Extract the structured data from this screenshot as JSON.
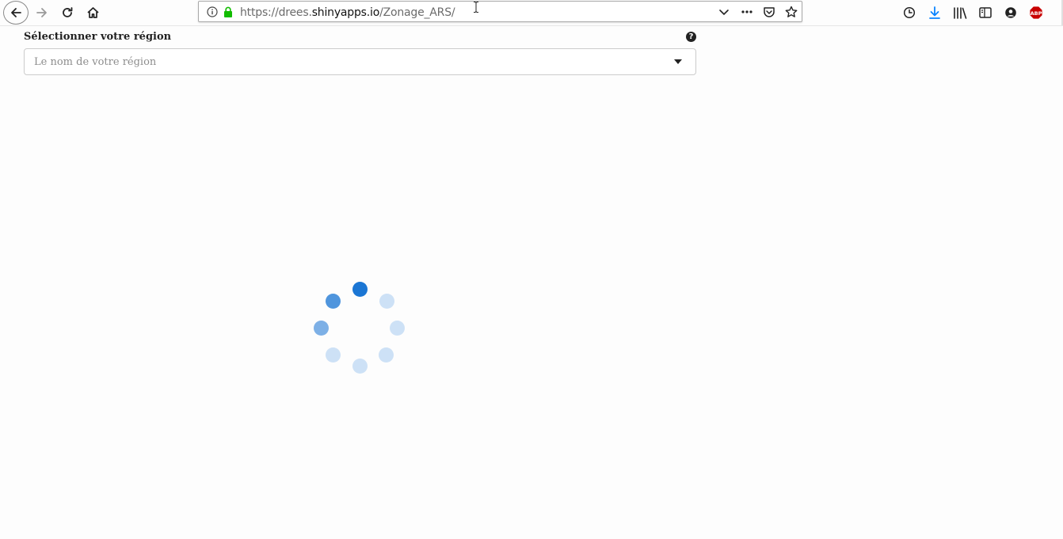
{
  "browser": {
    "url_prefix": "https://drees.",
    "url_domain": "shinyapps.io",
    "url_path": "/Zonage_ARS/",
    "adblock_label": "ABP"
  },
  "page": {
    "region_label": "Sélectionner votre région",
    "help_symbol": "?",
    "region_placeholder": "Le nom de votre région"
  },
  "spinner": {
    "colors": {
      "dark": "#1b76d4",
      "mid": "#4f95dd",
      "soft": "#7db0e6",
      "light": "#cde1f6"
    }
  }
}
